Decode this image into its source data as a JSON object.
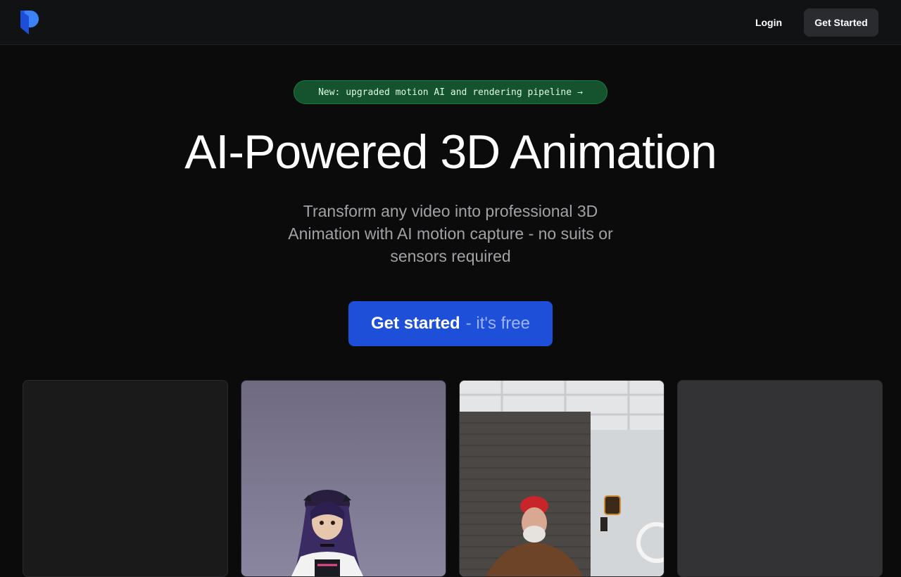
{
  "nav": {
    "login_label": "Login",
    "cta_label": "Get Started"
  },
  "announcement": {
    "text": "New: upgraded motion AI and rendering pipeline",
    "arrow": "→"
  },
  "hero": {
    "title": "AI-Powered 3D Animation",
    "subtitle": "Transform any video into professional 3D Animation with AI motion capture - no suits or sensors required",
    "cta_primary": "Get started",
    "cta_secondary": "- it's free"
  },
  "colors": {
    "accent": "#1d4fd8",
    "badge_bg": "#14532d",
    "background": "#0b0b0c"
  },
  "icons": {
    "logo": "brand-logo-icon",
    "arrow": "arrow-right-icon"
  }
}
